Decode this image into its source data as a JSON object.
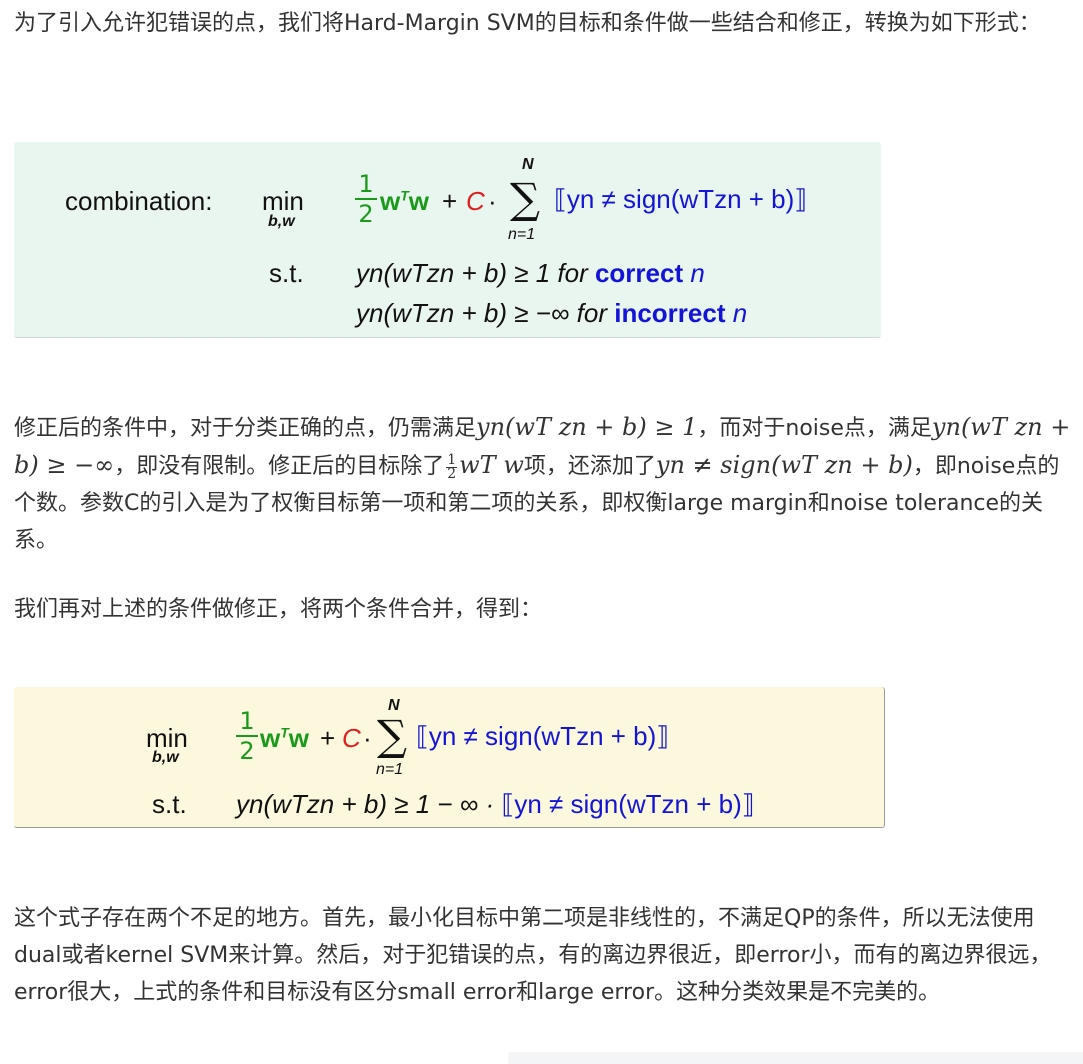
{
  "p1": {
    "text": "为了引入允许犯错误的点，我们将Hard-Margin SVM的目标和条件做一些结合和修正，转换为如下形式："
  },
  "formula1": {
    "combination_label": "combination:",
    "min": "min",
    "min_sub": "b,w",
    "half_num": "1",
    "half_den": "2",
    "w": "w",
    "T": "T",
    "plus": "+",
    "C": "C",
    "dot": "·",
    "sum_top": "N",
    "sum_bot": "n=1",
    "indicator": "yn ≠ sign(wTzn + b)",
    "st": "s.t.",
    "c1_left": "yn(wTzn + b) ≥ 1 for",
    "c1_kw": "correct",
    "c1_n": "n",
    "c2_left": "yn(wTzn + b) ≥ −∞ for",
    "c2_kw": "incorrect",
    "c2_n": "n"
  },
  "p2": {
    "s1": "修正后的条件中，对于分类正确的点，仍需满足",
    "m1": "yn(wT zn + b) ≥ 1",
    "s2": "，而对于noise点，满足",
    "m2": "yn(wT zn + b) ≥ −∞",
    "s3": "，即没有限制。修正后的目标除了",
    "m3a": "1",
    "m3b": "2",
    "m3c": "wT w",
    "s4": "项，还添加了",
    "m4": "yn ≠ sign(wT zn + b)",
    "s5": "，即noise点的个数。参数C的引入是为了权衡目标第一项和第二项的关系，即权衡large margin和noise tolerance的关系。"
  },
  "p3": {
    "text": "我们再对上述的条件做修正，将两个条件合并，得到："
  },
  "formula2": {
    "min": "min",
    "min_sub": "b,w",
    "half_num": "1",
    "half_den": "2",
    "sum_top": "N",
    "sum_bot": "n=1",
    "st": "s.t.",
    "c_left": "yn(wTzn + b) ≥ 1 − ∞ ·",
    "indicator": "yn ≠ sign(wTzn + b)"
  },
  "p4": {
    "text": "这个式子存在两个不足的地方。首先，最小化目标中第二项是非线性的，不满足QP的条件，所以无法使用dual或者kernel SVM来计算。然后，对于犯错误的点，有的离边界很近，即error小，而有的离边界很远，error很大，上式的条件和目标没有区分small error和large error。这种分类效果是不完美的。"
  },
  "colors": {
    "box1_bg": "#e9f5ef",
    "box2_bg": "#fcf8dd",
    "green": "#1a9a1a",
    "blue": "#1414d8",
    "red": "#e02020"
  }
}
